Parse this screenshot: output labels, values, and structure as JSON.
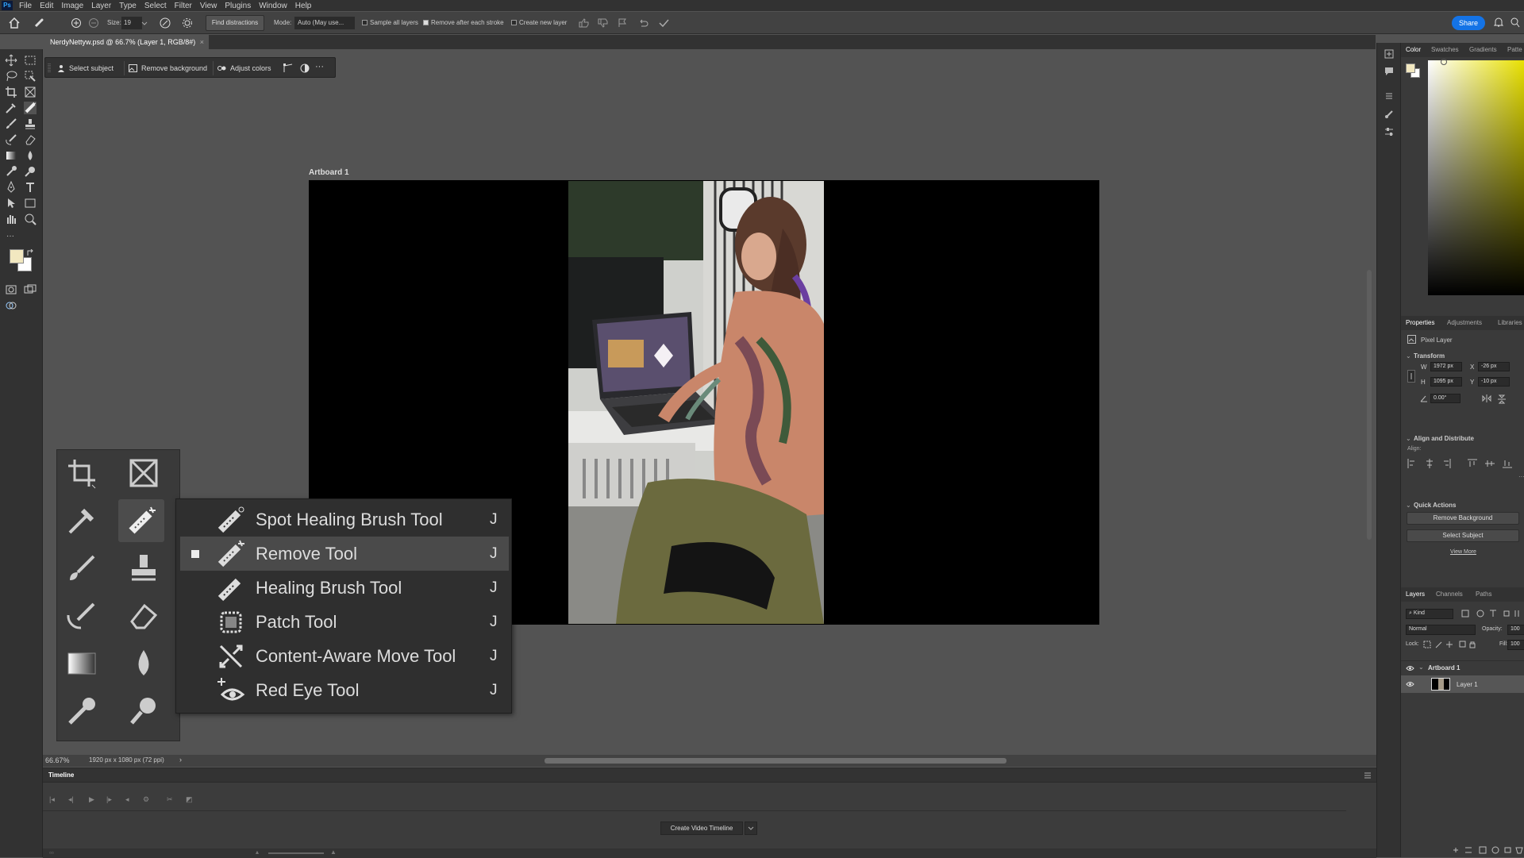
{
  "menubar": {
    "logo": "Ps",
    "items": [
      "File",
      "Edit",
      "Image",
      "Layer",
      "Type",
      "Select",
      "Filter",
      "View",
      "Plugins",
      "Window",
      "Help"
    ]
  },
  "options": {
    "size_label": "Size:",
    "size_value": "19",
    "find_distractions": "Find distractions",
    "mode_label": "Mode:",
    "mode_value": "Auto (May use...",
    "sample_all_layers": "Sample all layers",
    "remove_after_stroke": "Remove after each stroke",
    "create_new_layer": "Create new layer",
    "share": "Share"
  },
  "document": {
    "tab_title": "NerdyNettyw.psd @ 66.7% (Layer 1, RGB/8#)",
    "artboard_title": "Artboard 1"
  },
  "context_bar": {
    "select_subject": "Select subject",
    "remove_background": "Remove background",
    "adjust_colors": "Adjust colors",
    "more": "···"
  },
  "submenu": {
    "items": [
      {
        "label": "Spot Healing Brush Tool",
        "key": "J",
        "icon": "spot-healing-icon"
      },
      {
        "label": "Remove Tool",
        "key": "J",
        "icon": "remove-tool-icon",
        "active": true
      },
      {
        "label": "Healing Brush Tool",
        "key": "J",
        "icon": "healing-brush-icon"
      },
      {
        "label": "Patch Tool",
        "key": "J",
        "icon": "patch-icon"
      },
      {
        "label": "Content-Aware Move Tool",
        "key": "J",
        "icon": "content-aware-move-icon"
      },
      {
        "label": "Red Eye Tool",
        "key": "J",
        "icon": "red-eye-icon"
      }
    ]
  },
  "status": {
    "zoom": "66.67%",
    "doc_info": "1920 px x 1080 px (72 ppi)"
  },
  "timeline": {
    "title": "Timeline",
    "create_button": "Create Video Timeline"
  },
  "color_panel": {
    "tabs": [
      "Color",
      "Swatches",
      "Gradients",
      "Patte"
    ]
  },
  "properties": {
    "tabs": [
      "Properties",
      "Adjustments",
      "Libraries"
    ],
    "layer_type": "Pixel Layer",
    "transform_title": "Transform",
    "w_label": "W",
    "w_value": "1972 px",
    "x_label": "X",
    "x_value": "-26 px",
    "h_label": "H",
    "h_value": "1095 px",
    "y_label": "Y",
    "y_value": "-10 px",
    "angle_value": "0.00°",
    "align_title": "Align and Distribute",
    "align_label": "Align:",
    "quick_actions_title": "Quick Actions",
    "remove_background": "Remove Background",
    "select_subject": "Select Subject",
    "view_more": "View More"
  },
  "layers": {
    "tabs": [
      "Layers",
      "Channels",
      "Paths"
    ],
    "kind": "Kind",
    "blend_mode": "Normal",
    "opacity_label": "Opacity:",
    "opacity_value": "100",
    "lock_label": "Lock:",
    "fill_label": "Fill:",
    "fill_value": "100",
    "items": [
      {
        "name": "Artboard 1"
      },
      {
        "name": "Layer 1"
      }
    ]
  },
  "colors": {
    "accent": "#1473e6",
    "foreground_swatch": "#f2e8c0",
    "background_swatch": "#ffffff",
    "panel_bg": "#3a3a3a",
    "canvas_bg": "#535353"
  }
}
